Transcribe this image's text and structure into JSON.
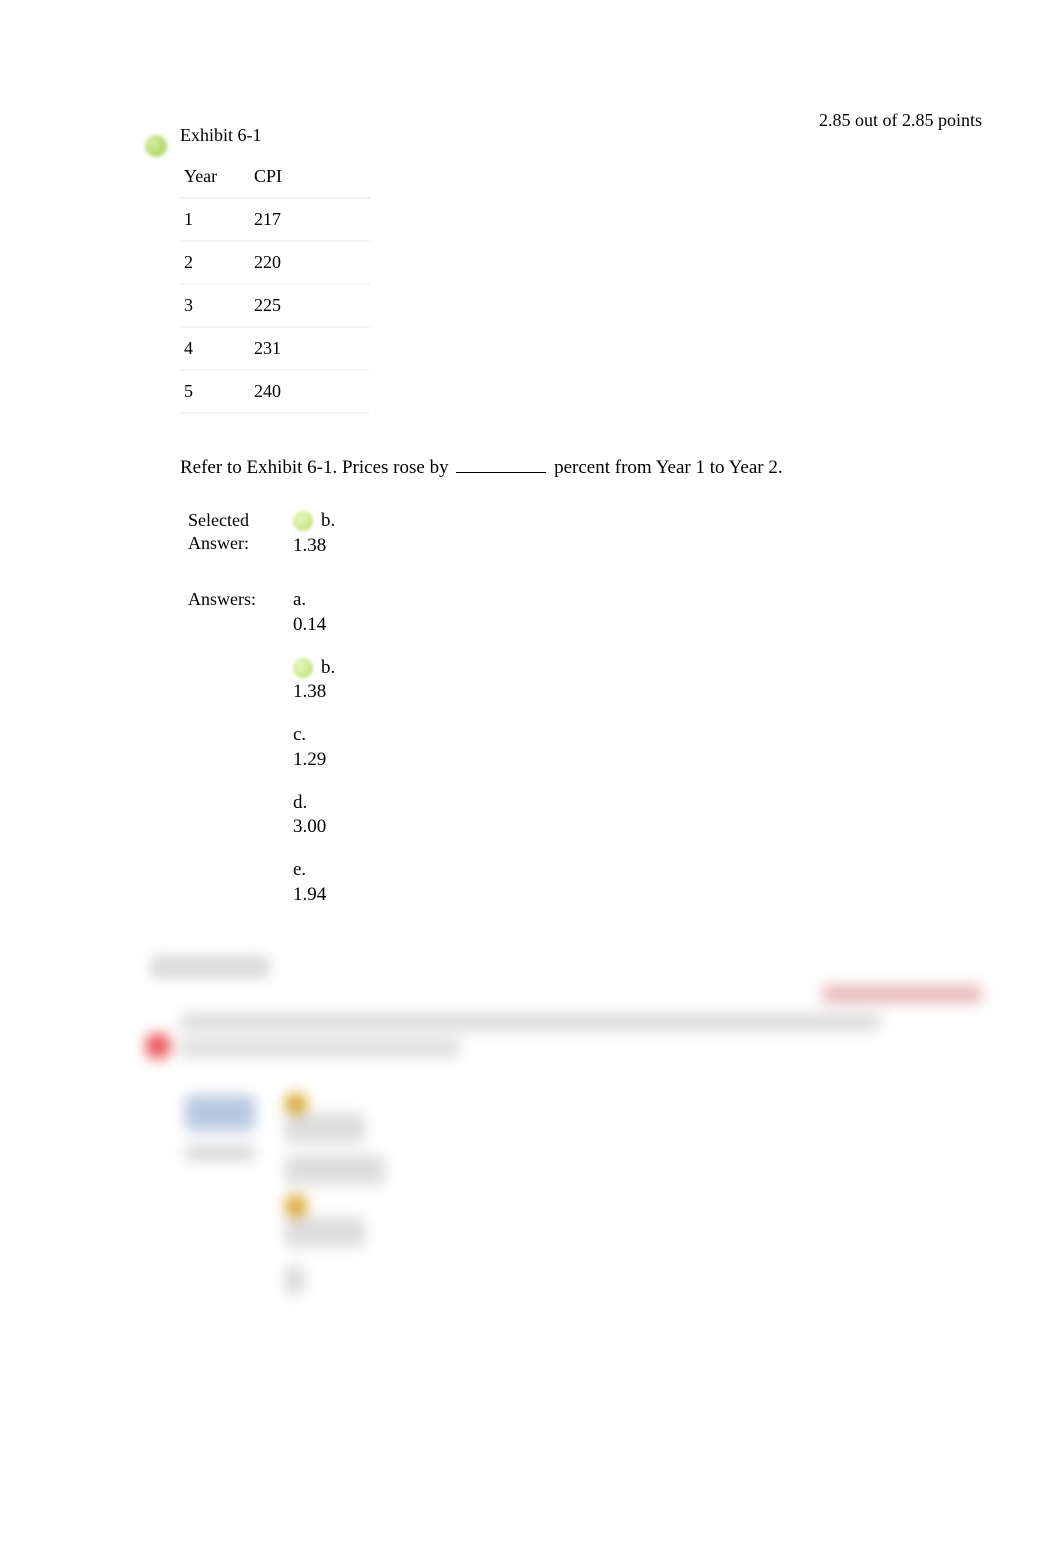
{
  "question": {
    "points_text": "2.85 out of 2.85 points",
    "exhibit_title": "Exhibit 6-1",
    "table": {
      "headers": [
        "Year",
        "CPI"
      ],
      "rows": [
        [
          "1",
          "217"
        ],
        [
          "2",
          "220"
        ],
        [
          "3",
          "225"
        ],
        [
          "4",
          "231"
        ],
        [
          "5",
          "240"
        ]
      ]
    },
    "prompt_prefix": "Refer to Exhibit 6-1. Prices rose by ",
    "prompt_suffix": " percent from Year 1 to Year 2.",
    "selected_label": "Selected Answer:",
    "answers_label": "Answers:",
    "selected_answer": {
      "letter": "b.",
      "value": "1.38"
    },
    "answers": [
      {
        "letter": "a.",
        "value": "0.14",
        "correct": false
      },
      {
        "letter": "b.",
        "value": "1.38",
        "correct": true
      },
      {
        "letter": "c.",
        "value": "1.29",
        "correct": false
      },
      {
        "letter": "d.",
        "value": "3.00",
        "correct": false
      },
      {
        "letter": "e.",
        "value": "1.94",
        "correct": false
      }
    ]
  },
  "chart_data": {
    "type": "table",
    "title": "Exhibit 6-1",
    "columns": [
      "Year",
      "CPI"
    ],
    "rows": [
      {
        "Year": 1,
        "CPI": 217
      },
      {
        "Year": 2,
        "CPI": 220
      },
      {
        "Year": 3,
        "CPI": 225
      },
      {
        "Year": 4,
        "CPI": 231
      },
      {
        "Year": 5,
        "CPI": 240
      }
    ]
  }
}
